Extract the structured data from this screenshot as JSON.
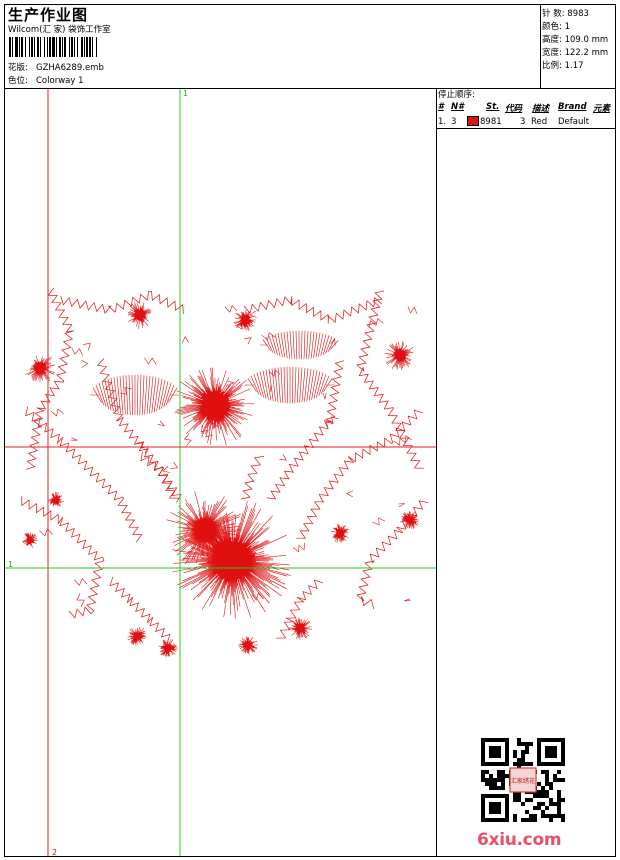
{
  "header": {
    "title": "生产作业图",
    "company": "Wilcom(汇 家) 袋饰工作室",
    "design_file_label": "花版:",
    "design_file": "GZHA6289.emb",
    "colorway_label": "色位:",
    "colorway": "Colorway 1"
  },
  "stats": [
    {
      "label": "针 数:",
      "value": "8983"
    },
    {
      "label": "颜色:",
      "value": "1"
    },
    {
      "label": "高度:",
      "value": "109.0 mm"
    },
    {
      "label": "宽度:",
      "value": "122.2 mm"
    },
    {
      "label": "比例:",
      "value": "1.17"
    }
  ],
  "stop_sequence": {
    "title": "停止顺序:",
    "headers": [
      "#",
      "N#",
      "St.",
      "代码",
      "描述",
      "Brand",
      "元素"
    ],
    "rows": [
      {
        "num": "1.",
        "n": "3",
        "color": "#e01010",
        "st": "8981",
        "code": "3",
        "desc": "Red",
        "brand": "Default",
        "elements": ""
      }
    ]
  },
  "guides": {
    "h_label": "1",
    "v1_label": "1",
    "v2_label": "2"
  },
  "colors": {
    "thread": "#e01010",
    "guide_red": "#e02020",
    "guide_green": "#22cc22"
  },
  "watermark": "6xiu.com",
  "qr_badge": "汇家绣花"
}
